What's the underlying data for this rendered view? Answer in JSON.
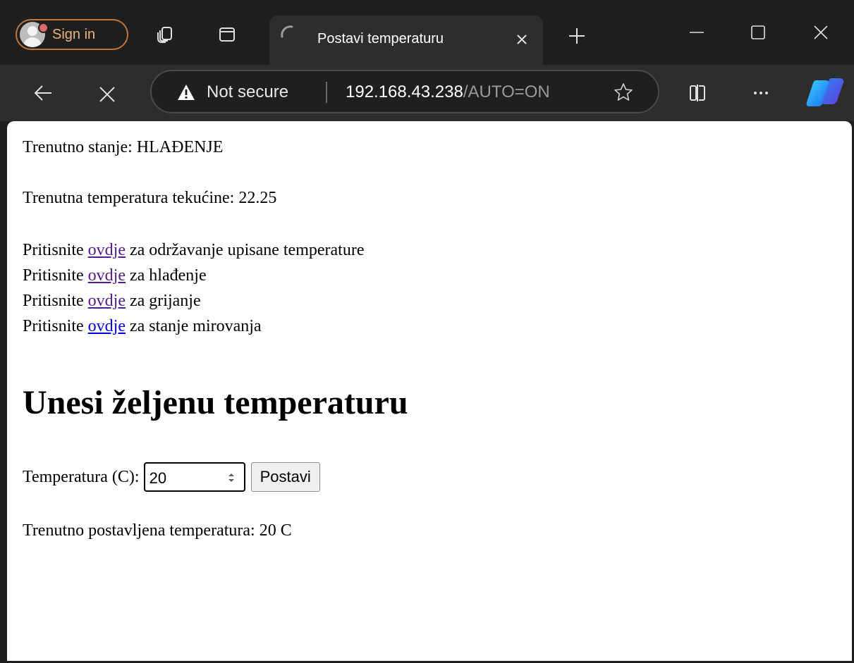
{
  "browser": {
    "profile_label": "Sign in",
    "tab": {
      "title": "Postavi temperaturu"
    },
    "address": {
      "security_label": "Not secure",
      "url_host": "192.168.43.238",
      "url_path": "/AUTO=ON"
    },
    "colors": {
      "frame": "#1f1f1f",
      "toolbar": "#2d2d2d",
      "profile_accent": "#c2743a"
    }
  },
  "page": {
    "state_prefix": "Trenutno stanje: ",
    "state_value": "HLAĐENJE",
    "temp_prefix": "Trenutna temperatura tekućine: ",
    "temp_value": "22.25",
    "actions": [
      {
        "prefix": "Pritisnite ",
        "link": "ovdje",
        "suffix": " za održavanje upisane temperature",
        "visited": true
      },
      {
        "prefix": "Pritisnite ",
        "link": "ovdje",
        "suffix": " za hlađenje",
        "visited": true
      },
      {
        "prefix": "Pritisnite ",
        "link": "ovdje",
        "suffix": " za grijanje",
        "visited": true
      },
      {
        "prefix": "Pritisnite ",
        "link": "ovdje",
        "suffix": " za stanje mirovanja",
        "visited": false
      }
    ],
    "heading": "Unesi željenu temperaturu",
    "form": {
      "label": "Temperatura (C): ",
      "value": "20",
      "button": "Postavi"
    },
    "current_set_prefix": "Trenutno postavljena temperatura: ",
    "current_set_value": "20",
    "current_set_unit": " C"
  }
}
